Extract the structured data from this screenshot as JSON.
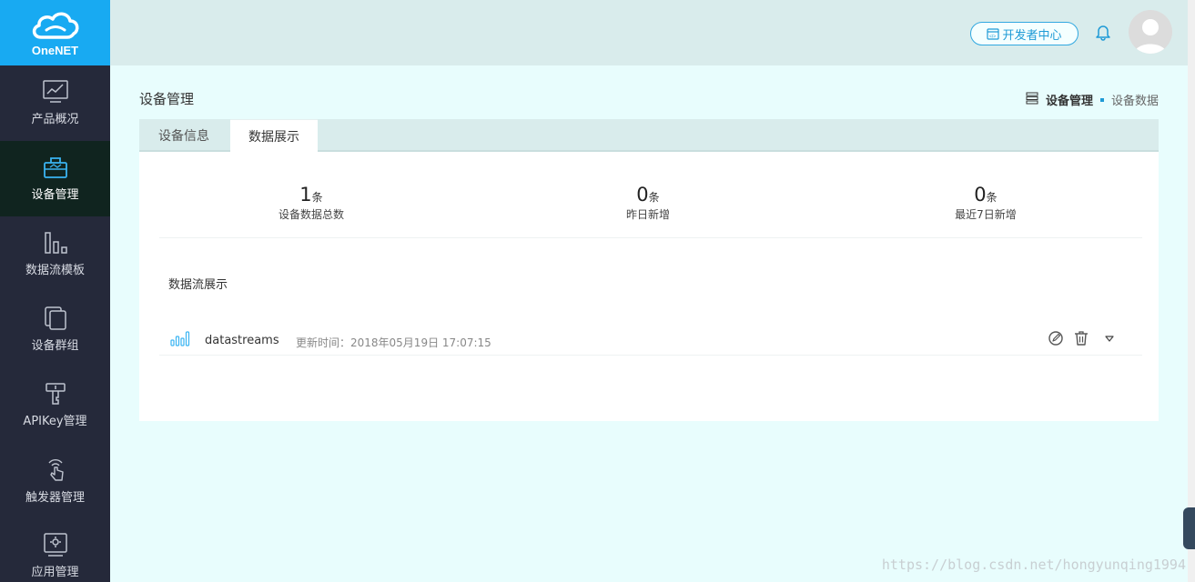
{
  "brand": {
    "name": "OneNET"
  },
  "sidebar": {
    "items": [
      {
        "label": "产品概况",
        "icon": "chart-monitor-icon"
      },
      {
        "label": "设备管理",
        "icon": "device-box-icon",
        "active": true
      },
      {
        "label": "数据流模板",
        "icon": "bars-icon"
      },
      {
        "label": "设备群组",
        "icon": "tablets-icon"
      },
      {
        "label": "APIKey管理",
        "icon": "key-icon"
      },
      {
        "label": "触发器管理",
        "icon": "touch-icon"
      },
      {
        "label": "应用管理",
        "icon": "app-gear-icon"
      }
    ]
  },
  "header": {
    "dev_center_label": "开发者中心",
    "icons": [
      "dev-center-icon",
      "bell-icon",
      "avatar"
    ]
  },
  "page": {
    "title": "设备管理",
    "breadcrumb": {
      "main": "设备管理",
      "sub": "设备数据"
    }
  },
  "tabs": [
    {
      "label": "设备信息",
      "active": false
    },
    {
      "label": "数据展示",
      "active": true
    }
  ],
  "stats": [
    {
      "value": "1",
      "unit": "条",
      "label": "设备数据总数"
    },
    {
      "value": "0",
      "unit": "条",
      "label": "昨日新增"
    },
    {
      "value": "0",
      "unit": "条",
      "label": "最近7日新增"
    }
  ],
  "datastreams": {
    "title": "数据流展示",
    "rows": [
      {
        "name": "datastreams",
        "time": "更新时间：2018年05月19日 17:07:15"
      }
    ]
  },
  "watermark": "https://blog.csdn.net/hongyunqing1994",
  "colors": {
    "sidebar": "#25293a",
    "brand": "#18aaf2",
    "accent": "#1e9ad6",
    "header": "#d9ecec",
    "page": "#e8fdfd"
  }
}
